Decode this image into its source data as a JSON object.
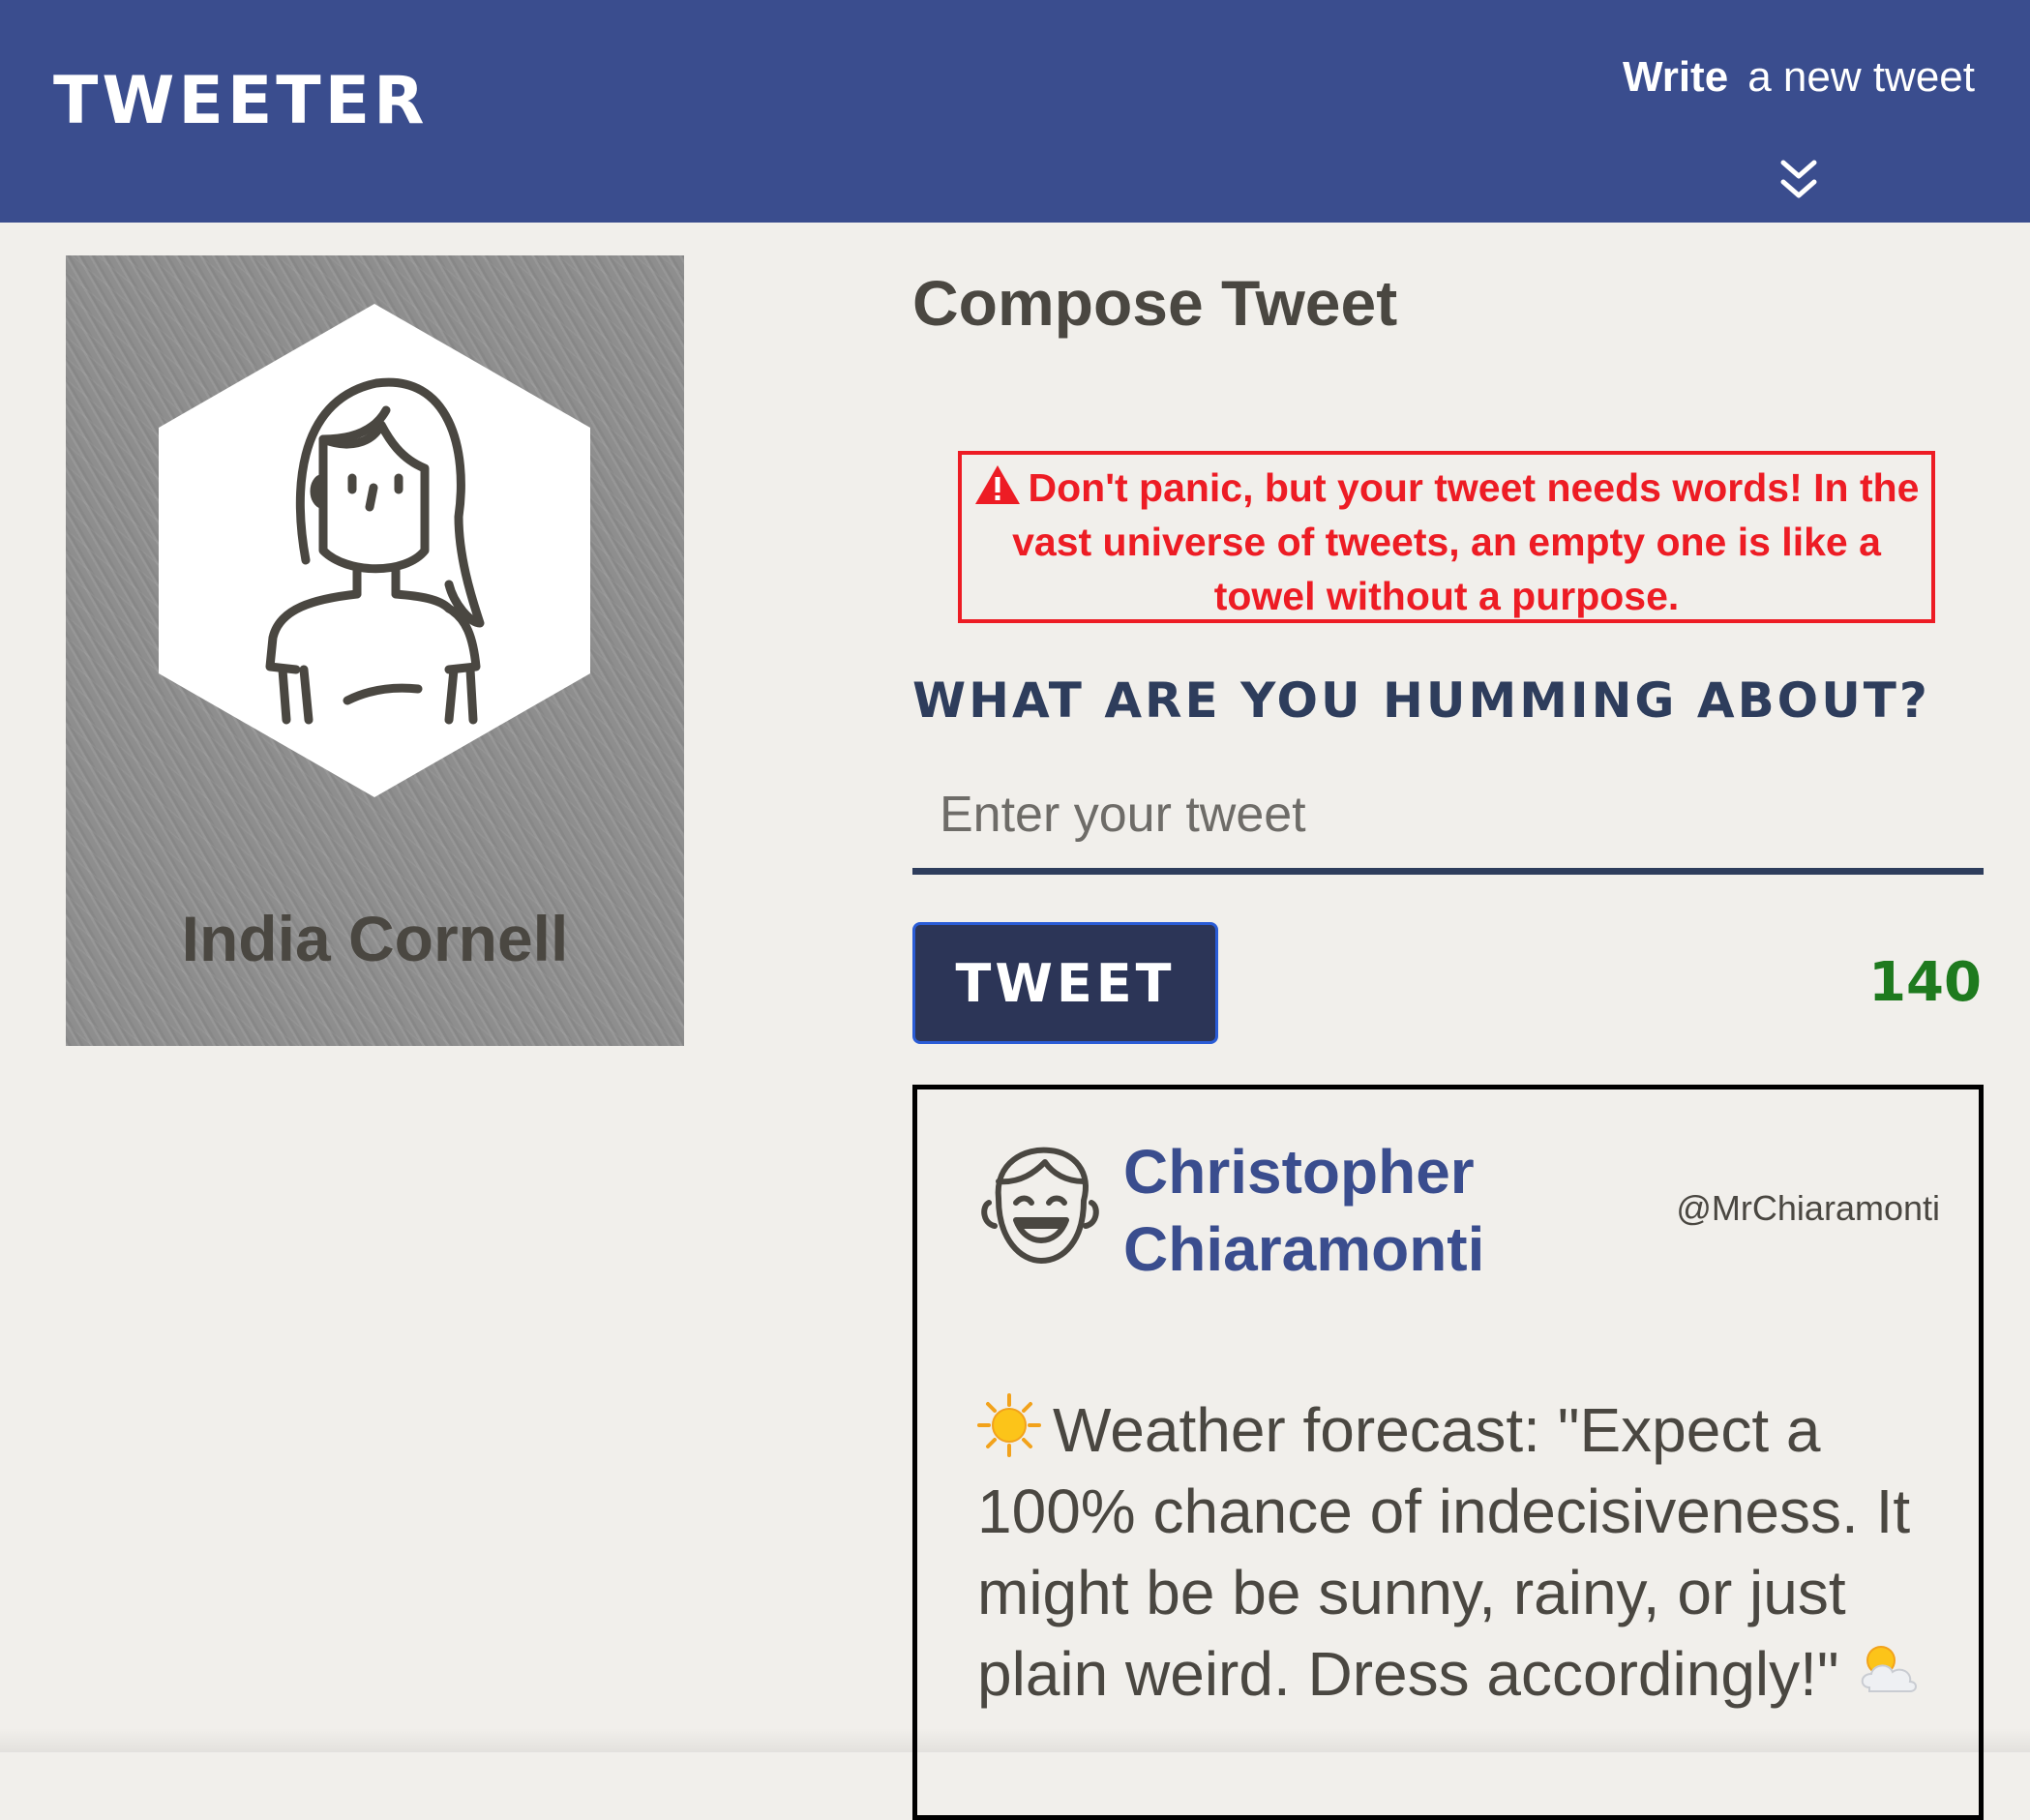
{
  "nav": {
    "brand": "Tweeter",
    "write_strong": "Write",
    "write_rest": "a new tweet",
    "toggle_icon": "double-chevron-down-icon"
  },
  "profile": {
    "avatar_icon": "woman-avatar-icon",
    "name": "India Cornell"
  },
  "compose": {
    "title": "Compose Tweet",
    "error_icon": "warning-triangle-icon",
    "error_message": "Don't panic, but your tweet needs words! In the vast universe of tweets, an empty one is like a towel without a purpose.",
    "label": "What are you humming about?",
    "input_placeholder": "Enter your tweet",
    "input_value": "",
    "button_label": "Tweet",
    "counter": "140"
  },
  "tweets": [
    {
      "avatar_icon": "laughing-man-avatar-icon",
      "author": "Christopher Chiaramonti",
      "handle": "@MrChiaramonti",
      "text": "Weather forecast: \"Expect a 100% chance of indecisiveness. It might be be sunny, rainy, or just plain weird. Dress accordingly!\""
    }
  ],
  "colors": {
    "nav_bg": "#3a4d8e",
    "page_bg": "#f1efeb",
    "error": "#ed1c24",
    "label": "#2e3d5c",
    "button_bg": "#2c3557",
    "counter": "#1e7a1e",
    "author": "#3a4d8e"
  }
}
